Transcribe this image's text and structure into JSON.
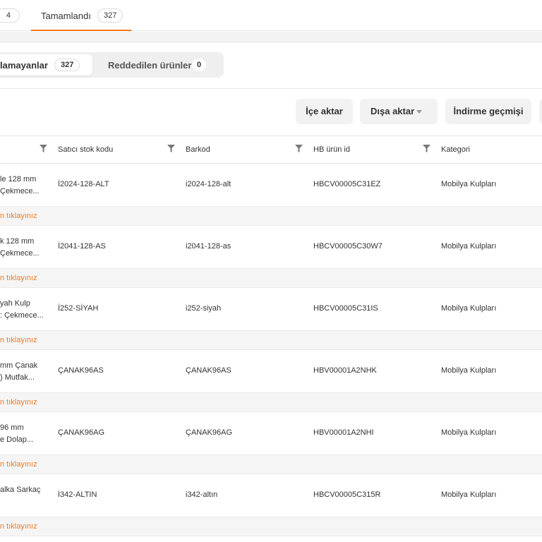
{
  "tabs": {
    "prev_count": "4",
    "active_label": "Tamamlandı",
    "active_count": "327"
  },
  "segment": {
    "a_label": "lamayanlar",
    "a_count": "327",
    "b_label": "Reddedilen ürünler",
    "b_count": "0"
  },
  "toolbar": {
    "import_label": "İçe aktar",
    "export_label": "Dışa aktar",
    "history_label": "İndirme geçmişi"
  },
  "table": {
    "columns": [
      "Satıcı stok kodu",
      "Barkod",
      "HB ürün id",
      "Kategori"
    ],
    "link_text": "n tıklayınız",
    "rows": [
      {
        "name": "le 128 mm\nÇekmece...",
        "stock": "İ2024-128-ALT",
        "barcode": "i2024-128-alt",
        "hbid": "HBCV00005C31EZ",
        "category": "Mobilya Kulpları"
      },
      {
        "name": "k 128 mm\nÇekmece...",
        "stock": "İ2041-128-AS",
        "barcode": "i2041-128-as",
        "hbid": "HBCV00005C30W7",
        "category": "Mobilya Kulpları"
      },
      {
        "name": "yah Kulp\n: Çekmece...",
        "stock": "İ252-SİYAH",
        "barcode": "i252-siyah",
        "hbid": "HBCV00005C31IS",
        "category": "Mobilya Kulpları"
      },
      {
        "name": "mm Çanak\n) Mutfak...",
        "stock": "ÇANAK96AS",
        "barcode": "ÇANAK96AS",
        "hbid": "HBV00001A2NHK",
        "category": "Mobilya Kulpları"
      },
      {
        "name": "96 mm\ne Dolap...",
        "stock": "ÇANAK96AG",
        "barcode": "ÇANAK96AG",
        "hbid": "HBV00001A2NHI",
        "category": "Mobilya Kulpları"
      },
      {
        "name": "alka Sarkaç",
        "stock": "İ342-ALTIN",
        "barcode": "i342-altın",
        "hbid": "HBCV00005C315R",
        "category": "Mobilya Kulpları"
      }
    ]
  },
  "colors": {
    "accent": "#f27a1a"
  },
  "icons": {
    "column_filter": "filter-icon",
    "export_caret": "chevron-down-icon"
  }
}
